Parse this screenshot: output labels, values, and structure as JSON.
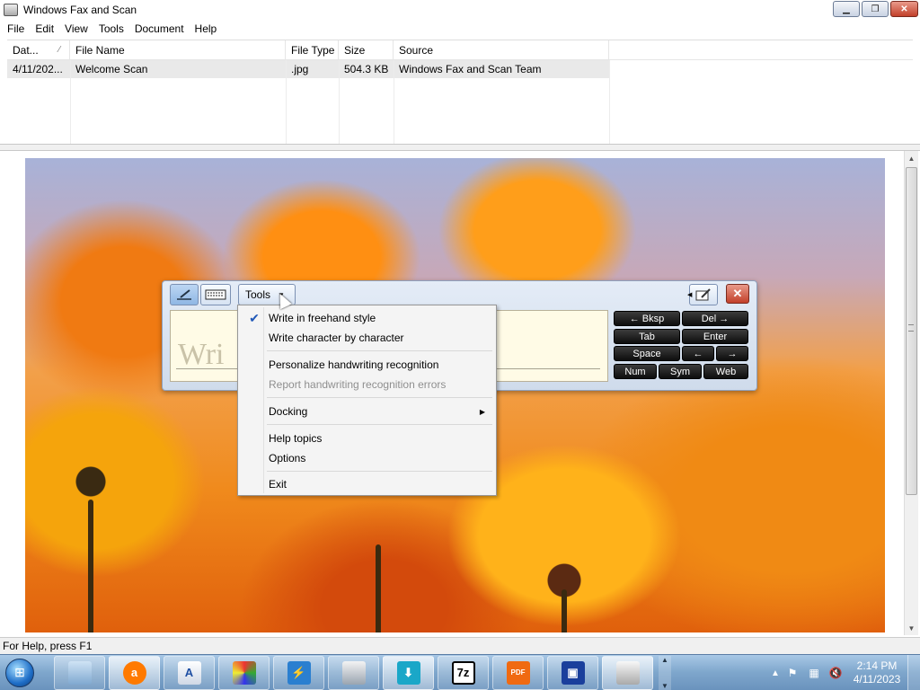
{
  "window": {
    "title": "Windows Fax and Scan"
  },
  "menubar": [
    "File",
    "Edit",
    "View",
    "Tools",
    "Document",
    "Help"
  ],
  "filelist": {
    "columns": [
      "Dat...",
      "File Name",
      "File Type",
      "Size",
      "Source"
    ],
    "sort_indicator": "⁄",
    "rows": [
      {
        "date": "4/11/202...",
        "name": "Welcome Scan",
        "type": ".jpg",
        "size": "504.3 KB",
        "source": "Windows Fax and Scan Team"
      }
    ]
  },
  "status": {
    "text": "For Help, press F1"
  },
  "input_panel": {
    "tools_label": "Tools",
    "ghost_text": "Wri",
    "keys": {
      "bksp": "← Bksp",
      "del": "Del →",
      "tab": "Tab",
      "enter": "Enter",
      "space": "Space",
      "left": "←",
      "right": "→",
      "num": "Num",
      "sym": "Sym",
      "web": "Web"
    }
  },
  "tools_menu": {
    "items": [
      {
        "label": "Write in freehand style",
        "checked": true,
        "enabled": true
      },
      {
        "label": "Write character by character",
        "checked": false,
        "enabled": true
      },
      {
        "label": "Personalize handwriting recognition",
        "checked": false,
        "enabled": true
      },
      {
        "label": "Report handwriting recognition errors",
        "checked": false,
        "enabled": false
      },
      {
        "label": "Docking",
        "submenu": true,
        "enabled": true
      },
      {
        "label": "Help topics",
        "enabled": true
      },
      {
        "label": "Options",
        "enabled": true
      },
      {
        "label": "Exit",
        "enabled": true
      }
    ]
  },
  "taskbar": {
    "apps": [
      "windows-explorer",
      "avast",
      "notepad-word",
      "rubiks-app",
      "lightning-app",
      "scanner",
      "download-app",
      "7zip",
      "pdf-app",
      "save-app",
      "fax-scan"
    ],
    "seven_zip_label": "7z",
    "pdf_label": "PDF",
    "clock_time": "2:14 PM",
    "clock_date": "4/11/2023"
  }
}
